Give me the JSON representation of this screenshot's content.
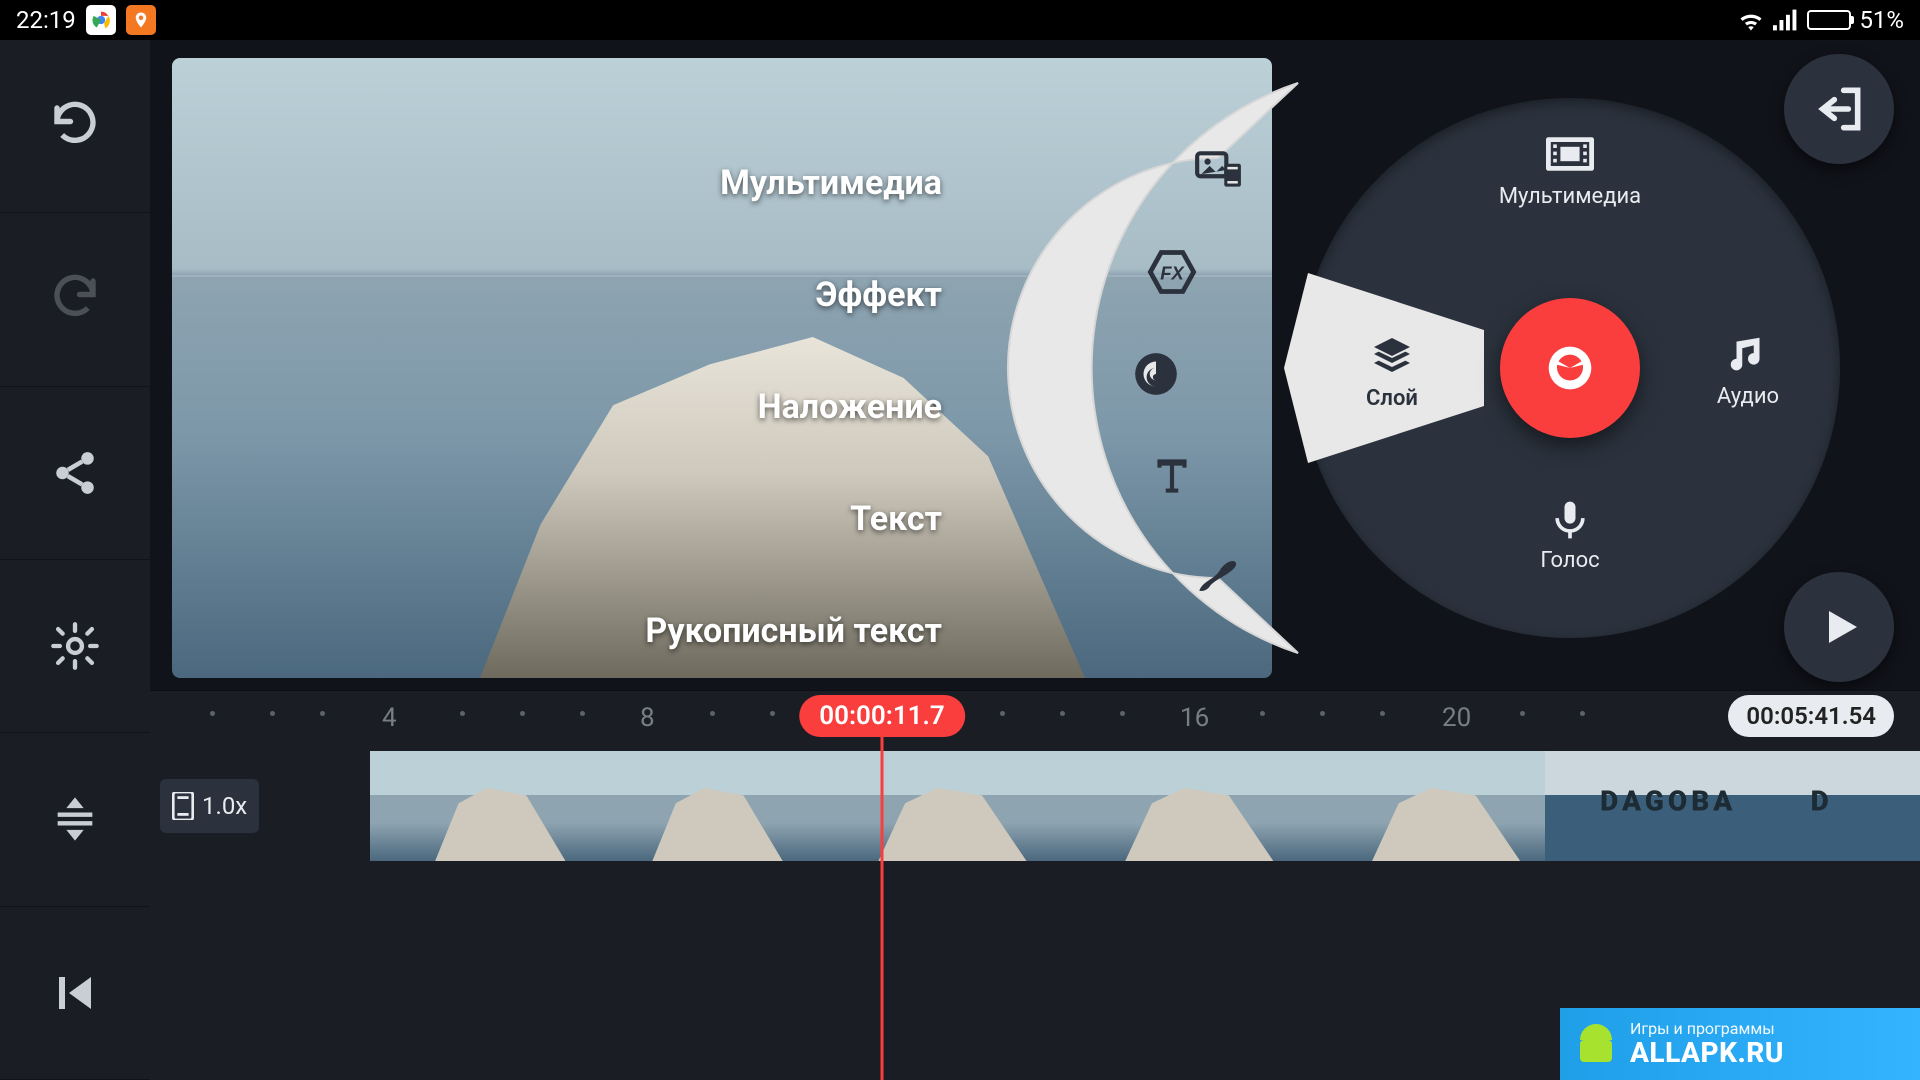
{
  "status": {
    "time": "22:19",
    "battery": "51%"
  },
  "left_rail": {
    "undo": "undo",
    "redo": "redo",
    "share": "share",
    "settings": "settings",
    "tracks": "tracks",
    "rewind": "rewind"
  },
  "preview": {
    "labels": {
      "multimedia": "Мультимедиа",
      "effect": "Эффект",
      "overlay": "Наложение",
      "text": "Текст",
      "handwriting": "Рукописный текст"
    }
  },
  "radial": {
    "top": "Мультимедиа",
    "right": "Аудио",
    "bottom": "Голос",
    "left": "Слой"
  },
  "corner": {
    "exit": "exit",
    "play": "play"
  },
  "timeline": {
    "marks": [
      "4",
      "8",
      "16",
      "20"
    ],
    "playhead": "00:00:11.7",
    "duration": "00:05:41.54",
    "speed": "1.0x",
    "brand_clip_text": "DAGOBA"
  },
  "watermark": {
    "sub": "Игры и программы",
    "main": "ALLAPK.RU"
  }
}
